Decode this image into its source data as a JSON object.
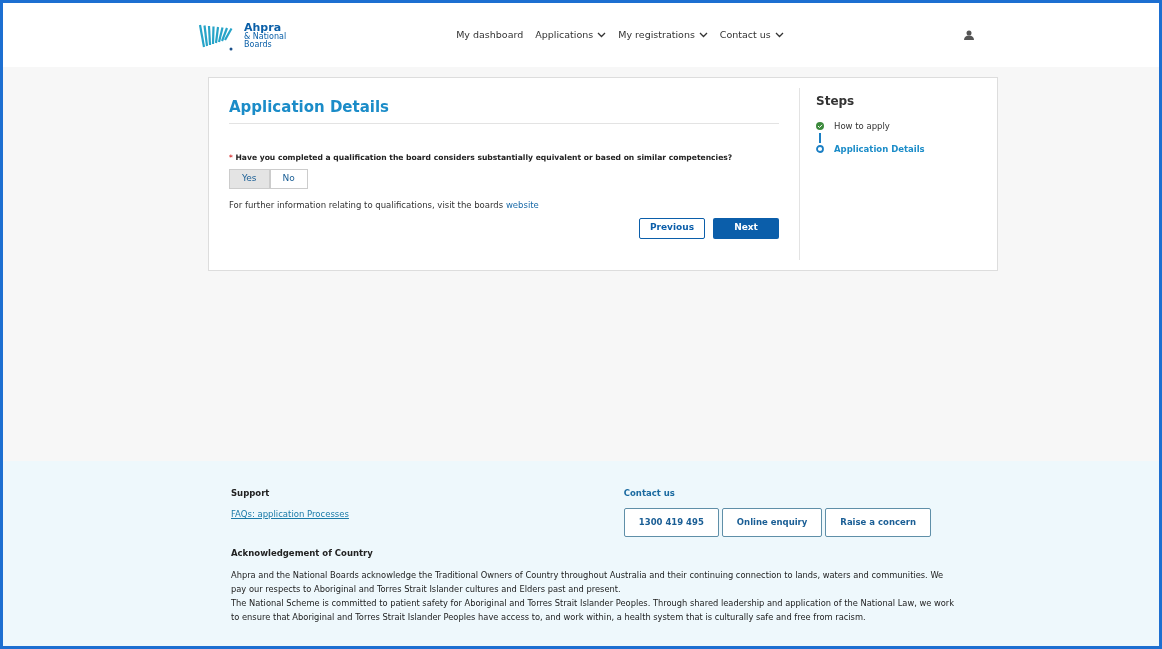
{
  "header": {
    "logo": {
      "name": "Ahpra",
      "subtitle_1": "& National",
      "subtitle_2": "Boards"
    },
    "nav": [
      {
        "label": "My dashboard",
        "dropdown": false
      },
      {
        "label": "Applications",
        "dropdown": true
      },
      {
        "label": "My registrations",
        "dropdown": true
      },
      {
        "label": "Contact us",
        "dropdown": true
      }
    ]
  },
  "form": {
    "title": "Application Details",
    "question": {
      "required_mark": "*",
      "text": "Have you completed a qualification the board considers substantially equivalent or based on similar competencies?"
    },
    "options": [
      {
        "label": "Yes",
        "selected": true
      },
      {
        "label": "No",
        "selected": false
      }
    ],
    "info": {
      "text": "For further information relating to qualifications, visit the boards",
      "link": "website"
    },
    "buttons": [
      {
        "label": "Previous",
        "kind": "secondary"
      },
      {
        "label": "Next",
        "kind": "primary"
      }
    ]
  },
  "steps": {
    "title": "Steps",
    "items": [
      {
        "label": "How to apply",
        "completed": true,
        "selected": false
      },
      {
        "label": "Application Details",
        "completed": false,
        "selected": true
      }
    ]
  },
  "footer": {
    "support": {
      "title": "Support",
      "link": "FAQs: application Processes"
    },
    "contact": {
      "title": "Contact us",
      "buttons": [
        "1300 419 495",
        "Online enquiry",
        "Raise a concern"
      ]
    },
    "acknowledgement": {
      "title": "Acknowledgement of Country",
      "paragraphs": [
        "Ahpra and the National Boards acknowledge the Traditional Owners of Country throughout Australia and their continuing connection to lands, waters and communities. We pay our respects to Aboriginal and Torres Strait Islander cultures and Elders past and present.",
        "The National Scheme is committed to patient safety for Aboriginal and Torres Strait Islander Peoples. Through shared leadership and application of the National Law, we work to ensure that Aboriginal and Torres Strait Islander Peoples have access to, and work within, a health system that is culturally safe and free from racism."
      ]
    }
  }
}
